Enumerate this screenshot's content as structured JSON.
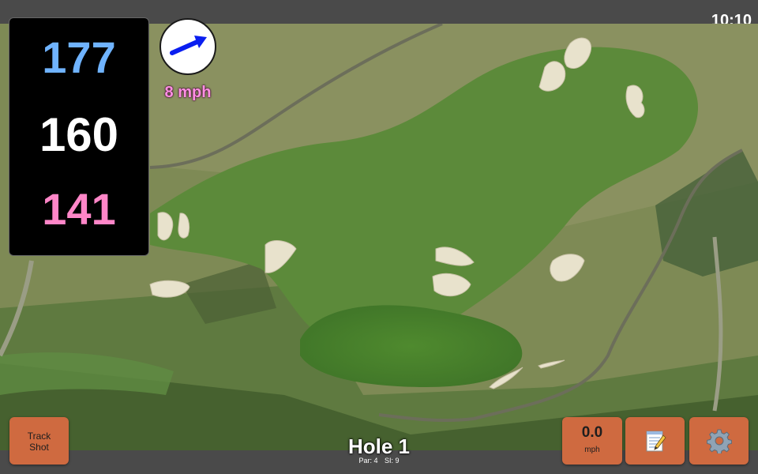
{
  "status_bar": {
    "time": "10:10"
  },
  "distances": {
    "back": "177",
    "middle": "160",
    "front": "141"
  },
  "wind": {
    "speed_label": "8 mph",
    "arrow_icon": "wind-arrow-icon",
    "arrow_color": "#0a1ef0"
  },
  "hole": {
    "title": "Hole 1",
    "par": "Par: 4",
    "si": "SI: 9"
  },
  "buttons": {
    "track_shot": {
      "line1": "Track",
      "line2": "Shot"
    },
    "speed": {
      "value": "0.0",
      "unit": "mph"
    },
    "notes": {
      "icon": "notepad-icon"
    },
    "settings": {
      "icon": "gear-icon"
    }
  },
  "colors": {
    "button_bg": "#cf6a40",
    "back_distance": "#6fb3ff",
    "middle_distance": "#ffffff",
    "front_distance": "#ff86c8",
    "wind_label": "#ff8fe3"
  }
}
